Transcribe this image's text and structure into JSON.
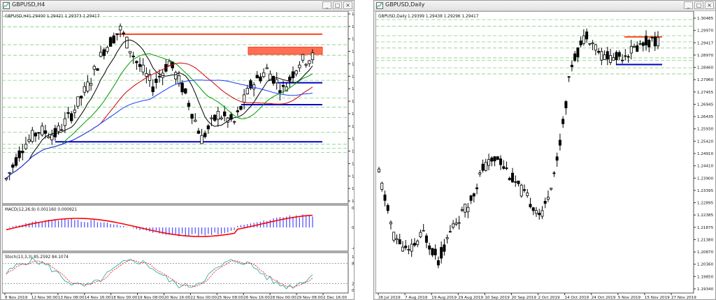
{
  "left_window": {
    "title": "GBPUSD,H4",
    "ohlc": "1.29400 1.29421 1.29373 1.29417",
    "price_ticks": [
      "1.29940",
      "1.29785",
      "1.29630",
      "1.29475",
      "1.29320",
      "1.29165",
      "1.29015",
      "1.28860",
      "1.28705",
      "1.28555",
      "1.28400",
      "1.28245",
      "1.28090",
      "1.27940",
      "1.27785",
      "1.27630"
    ],
    "time_labels": [
      "8 Nov 2019",
      "12 Nov 00:00",
      "13 Nov 08:00",
      "14 Nov 16:00",
      "18 Nov 00:00",
      "19 Nov 08:00",
      "20 Nov 16:00",
      "22 Nov 00:00",
      "25 Nov 08:00",
      "26 Nov 16:00",
      "28 Nov 00:00",
      "29 Nov 08:00",
      "2 Dec 16:00"
    ],
    "macd_label": "MACD(12,26,9) 0.001160 0.000921",
    "macd_ticks": [
      "0.003184",
      "0.00",
      "-0.003112"
    ],
    "stoch_label": "Stoch(13,3,3) 85.2592 84.1074",
    "stoch_ticks": [
      "100",
      "80",
      "20",
      "0"
    ]
  },
  "right_window": {
    "title": "GBPUSD,Daily",
    "ohlc": "1.29399 1.29438 1.29296 1.29417",
    "price_ticks": [
      "1.30485",
      "1.29970",
      "1.29417",
      "1.28970",
      "1.28460",
      "1.27960",
      "1.27455",
      "1.26945",
      "1.26435",
      "1.25930",
      "1.25420",
      "1.24910",
      "1.24410",
      "1.23900",
      "1.23395",
      "1.22895",
      "1.22385",
      "1.21875",
      "1.21380",
      "1.20870",
      "1.20360",
      "1.19850",
      "1.19340"
    ],
    "time_labels": [
      "26 Jul 2019",
      "7 Aug 2019",
      "19 Aug 2019",
      "29 Aug 2019",
      "10 Sep 2019",
      "20 Sep 2019",
      "2 Oct 2019",
      "14 Oct 2019",
      "24 Oct 2019",
      "5 Nov 2019",
      "15 Nov 2019",
      "27 Nov 2019"
    ]
  },
  "window_controls": {
    "minimize": "_",
    "maximize": "□",
    "close": "×"
  },
  "colors": {
    "resistance_line": "#ff4a1c",
    "resistance_zone": "#ff6f55",
    "support_line": "#0000c8",
    "macd_signal": "#ff0000",
    "macd_hist": "#4a4aff",
    "ma_red": "#d00000",
    "ma_green": "#009a00",
    "ma_blue": "#1a3cff",
    "ma_black": "#000000",
    "price_tag_bg": "#a9f0a9",
    "current_price_bg": "#000000"
  }
}
